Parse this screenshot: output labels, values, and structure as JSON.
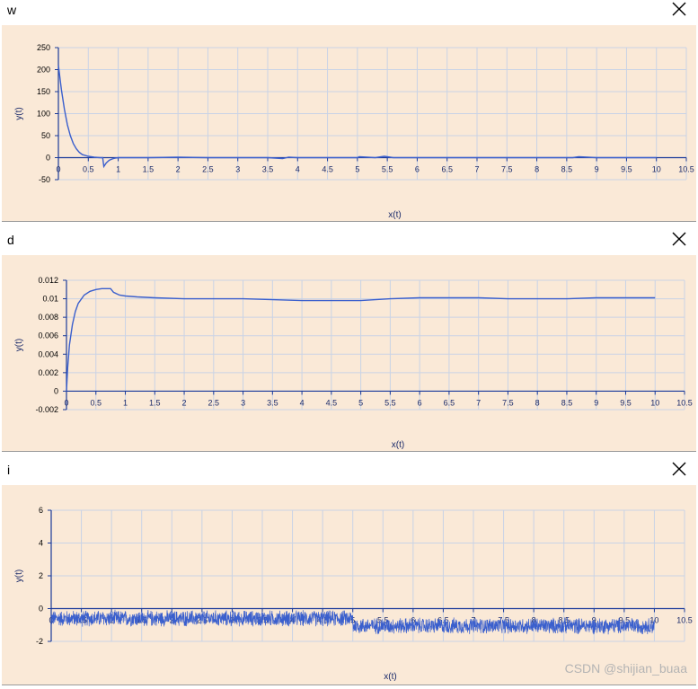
{
  "panels": [
    {
      "title": "w",
      "close_icon": "close-icon"
    },
    {
      "title": "d",
      "close_icon": "close-icon"
    },
    {
      "title": "i",
      "close_icon": "close-icon"
    }
  ],
  "watermark": "CSDN @shijian_buaa",
  "chart_data": [
    {
      "type": "line",
      "title": "w",
      "xlabel": "x(t)",
      "ylabel": "y(t)",
      "xlim": [
        0,
        10.5
      ],
      "ylim": [
        -50,
        250
      ],
      "xticks": [
        0,
        0.5,
        1,
        1.5,
        2,
        2.5,
        3,
        3.5,
        4,
        4.5,
        5,
        5.5,
        6,
        6.5,
        7,
        7.5,
        8,
        8.5,
        9,
        9.5,
        10,
        10.5
      ],
      "xtick_labels": [
        "0",
        "0.5",
        "1",
        "1.5",
        "2",
        "2.5",
        "3",
        "3.5",
        "4",
        "4.5",
        "5",
        "5.5",
        "6",
        "6.5",
        "7",
        "7.5",
        "8",
        "8.5",
        "9",
        "9.5",
        "10",
        "10.5"
      ],
      "yticks": [
        -50,
        0,
        50,
        100,
        150,
        200,
        250
      ],
      "ytick_labels": [
        "-50",
        "0",
        "50",
        "100",
        "150",
        "200",
        "250"
      ],
      "grid": true,
      "line_color": "#3a5fcd",
      "series": [
        {
          "x": [
            0,
            0.05,
            0.1,
            0.15,
            0.2,
            0.25,
            0.3,
            0.35,
            0.4,
            0.5,
            0.6,
            0.7,
            0.74,
            0.76,
            0.8,
            0.85,
            0.9,
            0.95,
            1.0,
            1.2,
            1.5,
            2,
            2.5,
            3,
            3.5,
            3.75,
            3.85,
            4,
            4.5,
            5,
            5.03,
            5.3,
            5.45,
            5.6,
            6,
            6.5,
            7,
            7.5,
            8,
            8.6,
            8.7,
            9,
            9.5,
            10
          ],
          "y": [
            210,
            155,
            110,
            75,
            50,
            32,
            20,
            12,
            7,
            3,
            1,
            0,
            0,
            -20,
            -12,
            -6,
            -3,
            -1,
            0,
            0,
            0,
            1,
            0,
            0,
            0,
            -2,
            1,
            0,
            0,
            0,
            2,
            0,
            3,
            0,
            0,
            0,
            0,
            0,
            0,
            0,
            2,
            0,
            0,
            0
          ]
        }
      ]
    },
    {
      "type": "line",
      "title": "d",
      "xlabel": "x(t)",
      "ylabel": "y(t)",
      "xlim": [
        0,
        10.5
      ],
      "ylim": [
        -0.002,
        0.012
      ],
      "xticks": [
        0,
        0.5,
        1,
        1.5,
        2,
        2.5,
        3,
        3.5,
        4,
        4.5,
        5,
        5.5,
        6,
        6.5,
        7,
        7.5,
        8,
        8.5,
        9,
        9.5,
        10,
        10.5
      ],
      "xtick_labels": [
        "0",
        "0.5",
        "1",
        "1.5",
        "2",
        "2.5",
        "3",
        "3.5",
        "4",
        "4.5",
        "5",
        "5.5",
        "6",
        "6.5",
        "7",
        "7.5",
        "8",
        "8.5",
        "9",
        "9.5",
        "10",
        "10.5"
      ],
      "yticks": [
        -0.002,
        0,
        0.002,
        0.004,
        0.006,
        0.008,
        0.01,
        0.012
      ],
      "ytick_labels": [
        "-0.002",
        "0",
        "0.002",
        "0.004",
        "0.006",
        "0.008",
        "0.01",
        "0.012"
      ],
      "grid": true,
      "line_color": "#3a5fcd",
      "series": [
        {
          "x": [
            0,
            0.02,
            0.05,
            0.1,
            0.15,
            0.2,
            0.3,
            0.4,
            0.5,
            0.6,
            0.7,
            0.75,
            0.8,
            0.9,
            1.0,
            1.2,
            1.5,
            2,
            2.5,
            3,
            3.5,
            4,
            4.5,
            5,
            5.5,
            6,
            6.5,
            7,
            7.5,
            8,
            8.5,
            9,
            9.5,
            10
          ],
          "y": [
            0,
            0.0025,
            0.005,
            0.0072,
            0.0086,
            0.0095,
            0.0104,
            0.0108,
            0.011,
            0.0111,
            0.0111,
            0.0111,
            0.0107,
            0.0104,
            0.0103,
            0.0102,
            0.0101,
            0.01,
            0.01,
            0.01,
            0.0099,
            0.0098,
            0.0098,
            0.0098,
            0.01,
            0.0101,
            0.0101,
            0.0101,
            0.01,
            0.01,
            0.01,
            0.0101,
            0.0101,
            0.0101
          ]
        }
      ]
    },
    {
      "type": "line",
      "title": "i",
      "xlabel": "x(t)",
      "ylabel": "y(t)",
      "xlim": [
        0,
        10.5
      ],
      "ylim": [
        -2,
        6
      ],
      "xticks": [
        0,
        0.5,
        1,
        1.5,
        2,
        2.5,
        3,
        3.5,
        4,
        4.5,
        5,
        5.5,
        6,
        6.5,
        7,
        7.5,
        8,
        8.5,
        9,
        9.5,
        10,
        10.5
      ],
      "xtick_labels": [
        "0",
        "0.5",
        "1",
        "1.5",
        "2",
        "2.5",
        "3",
        "3.5",
        "4",
        "4.5",
        "5",
        "5.5",
        "6",
        "6.5",
        "7",
        "7.5",
        "8",
        "8.5",
        "9",
        "9.5",
        "10",
        "10.5"
      ],
      "yticks": [
        -2,
        0,
        2,
        4,
        6
      ],
      "ytick_labels": [
        "-2",
        "0",
        "2",
        "4",
        "6"
      ],
      "grid": true,
      "line_color": "#3a5fcd",
      "noisy": true,
      "segments": [
        {
          "x_start": 0,
          "x_end": 5,
          "mean": -0.6,
          "amplitude": 0.55
        },
        {
          "x_start": 5,
          "x_end": 10,
          "mean": -1.05,
          "amplitude": 0.55
        }
      ]
    }
  ]
}
